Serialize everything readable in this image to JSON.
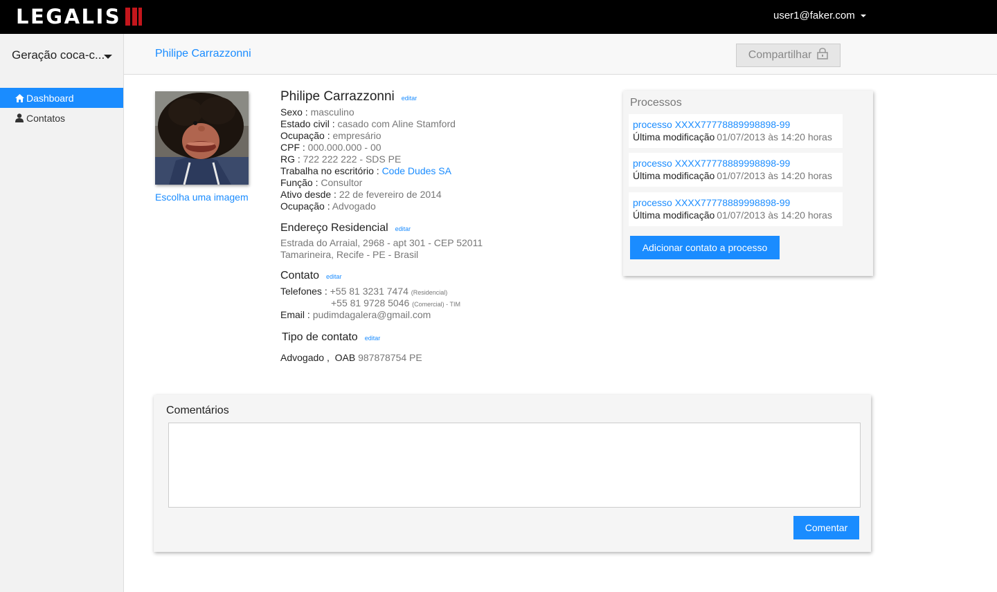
{
  "app": {
    "logo_text": "LEGALIS"
  },
  "header": {
    "user_email": "user1@faker.com"
  },
  "sidebar": {
    "org_name": "Geração coca-c...",
    "items": [
      {
        "label": "Dashboard",
        "icon": "home-icon",
        "active": true
      },
      {
        "label": "Contatos",
        "icon": "user-icon",
        "active": false
      }
    ]
  },
  "page": {
    "contact_name": "Philipe Carrazzonni",
    "share_label": "Compartilhar"
  },
  "profile": {
    "choose_image": "Escolha uma imagem",
    "name": "Philipe Carrazzonni",
    "edit_label": "editar",
    "fields": [
      {
        "label": "Sexo : ",
        "value": "masculino"
      },
      {
        "label": "Estado civil : ",
        "value": "casado com Aline Stamford"
      },
      {
        "label": "Ocupação : ",
        "value": "empresário"
      },
      {
        "label": "CPF : ",
        "value": "000.000.000 - 00"
      },
      {
        "label": "RG : ",
        "value": "722 222 222 - SDS PE"
      },
      {
        "label": "Trabalha no escritório : ",
        "value": "Code Dudes SA"
      },
      {
        "label": "Função : ",
        "value": "Consultor"
      },
      {
        "label": "Ativo desde : ",
        "value": "22 de fevereiro de 2014"
      },
      {
        "label": "Ocupação : ",
        "value": "Advogado"
      }
    ],
    "address": {
      "title": "Endereço Residencial",
      "line1": "Estrada do Arraial, 2968 - apt 301 - CEP 52011",
      "line2": "Tamarineira, Recife - PE - Brasil"
    },
    "contact": {
      "title": "Contato",
      "phones_label": "Telefones : ",
      "phone1": "+55 81 3231 7474",
      "phone1_type": "(Residencial)",
      "phone2": "+55 81 9728 5046",
      "phone2_type": "(Comercial) - TIM",
      "email_label": "Email : ",
      "email": "pudimdagalera@gmail.com"
    },
    "contact_type": {
      "title": "Tipo de contato",
      "type": "Advogado ,",
      "oab_label": "OAB",
      "oab_value": "987878754 PE"
    }
  },
  "processos": {
    "title": "Processos",
    "items": [
      {
        "link": "processo XXXX77778889998898-99",
        "mod_label": "Última modificação",
        "mod_value": "01/07/2013 às 14:20 horas"
      },
      {
        "link": "processo XXXX77778889998898-99",
        "mod_label": "Última modificação",
        "mod_value": "01/07/2013 às 14:20 horas"
      },
      {
        "link": "processo XXXX77778889998898-99",
        "mod_label": "Última modificação",
        "mod_value": "01/07/2013 às 14:20 horas"
      }
    ],
    "add_button": "Adicionar contato a processo"
  },
  "comments": {
    "title": "Comentários",
    "textarea_value": "",
    "submit_label": "Comentar"
  },
  "colors": {
    "accent": "#1a8cff",
    "brand_red": "#c4161c",
    "topbar": "#000000"
  }
}
